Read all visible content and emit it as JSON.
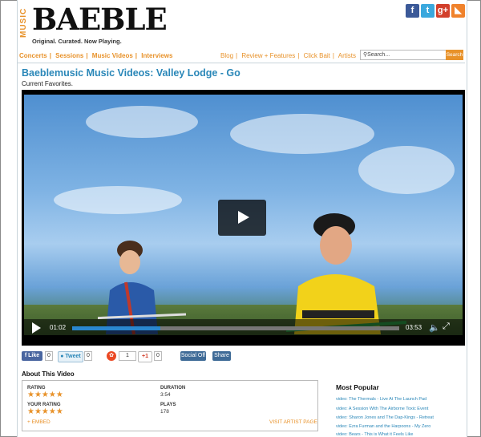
{
  "header": {
    "logo_music": "MUSIC",
    "logo_text": "BAEBLE",
    "tagline": "Original. Curated. Now Playing."
  },
  "social": [
    {
      "name": "facebook",
      "glyph": "f",
      "color": "#3b5998"
    },
    {
      "name": "twitter",
      "glyph": "t",
      "color": "#3aa8dd"
    },
    {
      "name": "googleplus",
      "glyph": "g+",
      "color": "#d23f2b"
    },
    {
      "name": "rss",
      "glyph": "◣",
      "color": "#f0822b"
    }
  ],
  "nav_left": [
    "Concerts",
    "Sessions",
    "Music Videos",
    "Interviews"
  ],
  "nav_right": [
    "Blog",
    "Review + Features",
    "Click Bait",
    "Artists"
  ],
  "search": {
    "placeholder": "Search...",
    "button": "Search"
  },
  "page": {
    "title": "Baeblemusic Music Videos: Valley Lodge - Go",
    "subtitle": "Current Favorites."
  },
  "player": {
    "current_time": "01:02",
    "duration": "03:53",
    "progress": 0.27
  },
  "share_bar": {
    "like": "Like",
    "like_count": "0",
    "tweet": "Tweet",
    "tweet_count": "0",
    "stumble_count": "1",
    "gplus": "+1",
    "gplus_count": "0",
    "social_off": "Social Off",
    "share": "Share"
  },
  "about": {
    "heading": "About This Video",
    "rating_label": "RATING",
    "your_rating_label": "YOUR RATING",
    "duration_label": "DURATION",
    "duration_value": "3:54",
    "plays_label": "PLAYS",
    "plays_value": "178",
    "embed": "+ EMBED",
    "artist_page": "VISIT ARTIST PAGE",
    "stars": "★★★★★",
    "your_stars": "★★★★★"
  },
  "popular": {
    "heading": "Most Popular",
    "items": [
      "video: The Thermals - Live At The Launch Pad",
      "video: A Session With The Airborne Toxic Event",
      "video: Sharon Jones and The Dap-Kings - Retreat",
      "video: Ezra Furman and the Harpoons - My Zero",
      "video: Bears - This is What it Feels Like"
    ]
  }
}
